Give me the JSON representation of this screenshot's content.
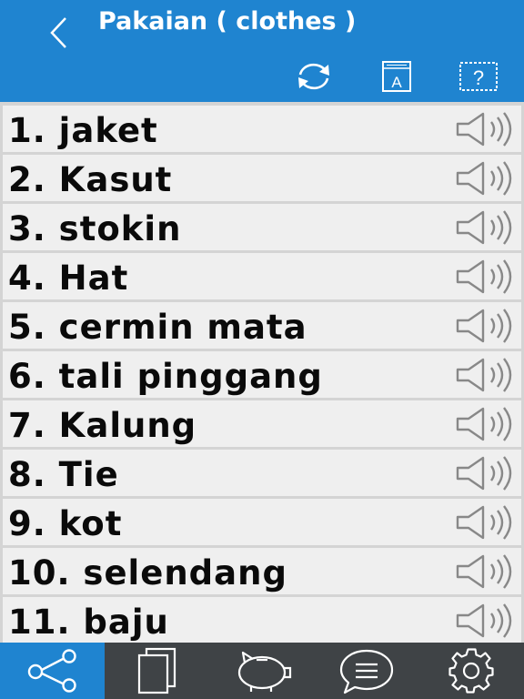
{
  "header": {
    "title": "Pakaian ( clothes )",
    "back_icon": "chevron-left-icon",
    "actions": [
      "refresh-icon",
      "dictionary-book-icon",
      "help-question-icon"
    ]
  },
  "list": {
    "items": [
      {
        "label": "1. jaket"
      },
      {
        "label": "2. Kasut"
      },
      {
        "label": "3. stokin"
      },
      {
        "label": "4. Hat"
      },
      {
        "label": "5. cermin mata"
      },
      {
        "label": "6. tali pinggang"
      },
      {
        "label": "7. Kalung"
      },
      {
        "label": "8. Tie"
      },
      {
        "label": "9. kot"
      },
      {
        "label": "10. selendang"
      },
      {
        "label": "11. baju"
      }
    ],
    "item_icon": "speaker-icon"
  },
  "tabbar": {
    "tabs": [
      "share-icon",
      "copy-pages-icon",
      "piggy-bank-icon",
      "chat-bubble-icon",
      "settings-gear-icon"
    ],
    "active_tab": "share-icon"
  },
  "colors": {
    "accent": "#1f84d0",
    "tabbar_bg": "#3f4346",
    "row_bg": "#efefef",
    "divider": "#d4d4d4"
  }
}
